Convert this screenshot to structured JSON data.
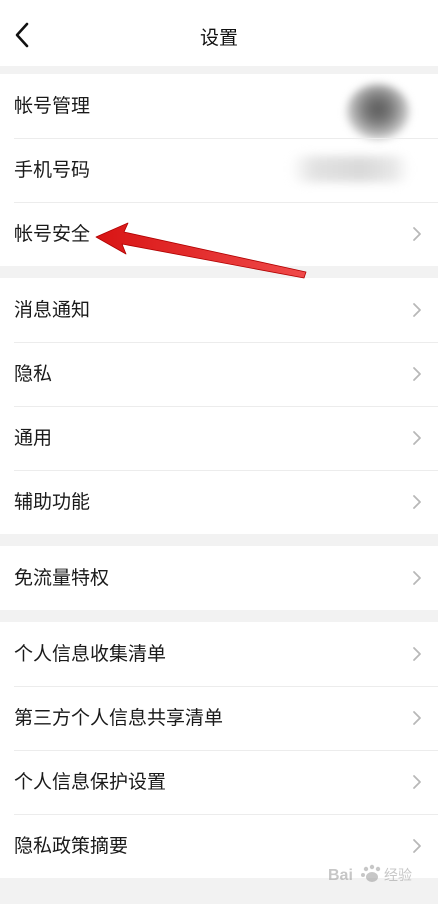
{
  "header": {
    "title": "设置"
  },
  "groups": [
    {
      "items": [
        {
          "label": "帐号管理"
        },
        {
          "label": "手机号码"
        },
        {
          "label": "帐号安全"
        }
      ]
    },
    {
      "items": [
        {
          "label": "消息通知"
        },
        {
          "label": "隐私"
        },
        {
          "label": "通用"
        },
        {
          "label": "辅助功能"
        }
      ]
    },
    {
      "items": [
        {
          "label": "免流量特权"
        }
      ]
    },
    {
      "items": [
        {
          "label": "个人信息收集清单"
        },
        {
          "label": "第三方个人信息共享清单"
        },
        {
          "label": "个人信息保护设置"
        },
        {
          "label": "隐私政策摘要"
        }
      ]
    }
  ],
  "icons": {
    "back": "chevron-left-icon",
    "row": "chevron-right-icon"
  },
  "colors": {
    "background": "#f2f2f2",
    "surface": "#ffffff",
    "annotation_arrow": "#e02020"
  },
  "watermark": {
    "text": "Bai 经验"
  }
}
